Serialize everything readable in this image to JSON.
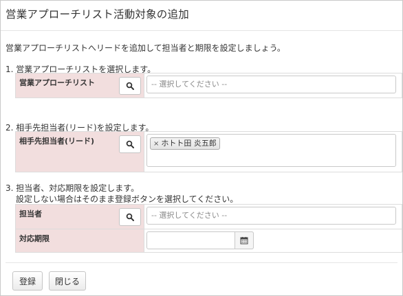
{
  "dialog": {
    "title": "営業アプローチリスト活動対象の追加",
    "intro": "営業アプローチリストへリードを追加して担当者と期限を設定しましょう。"
  },
  "step1": {
    "title": "1. 営業アプローチリストを選択します。",
    "field_label": "営業アプローチリスト",
    "placeholder": "-- 選択してください --"
  },
  "step2": {
    "title": "2. 相手先担当者(リード)を設定します。",
    "field_label": "相手先担当者(リード)",
    "chip_remove": "×",
    "selected_lead": "ホトト田 炎五郎"
  },
  "step3": {
    "title": "3. 担当者、対応期限を設定します。",
    "subtitle": "設定しない場合はそのまま登録ボタンを選択してください。",
    "assignee_label": "担当者",
    "assignee_placeholder": "-- 選択してください --",
    "deadline_label": "対応期限",
    "deadline_value": ""
  },
  "footer": {
    "register_label": "登録",
    "close_label": "閉じる"
  },
  "icons": {
    "search": "search-icon",
    "calendar": "calendar-icon"
  }
}
